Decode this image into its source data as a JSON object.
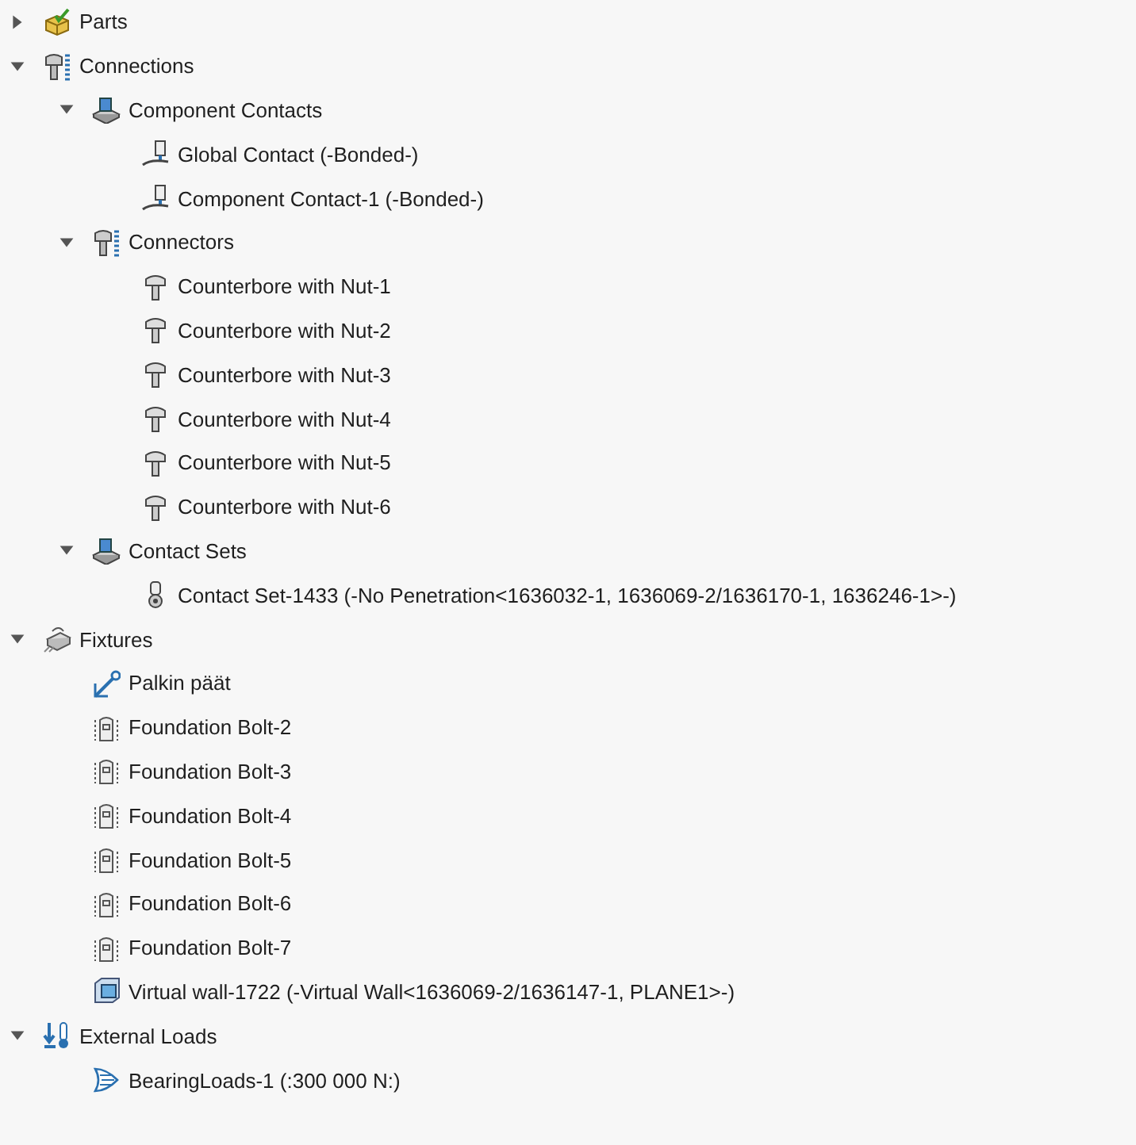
{
  "tree": [
    {
      "label": "Parts",
      "kind": "parts",
      "expanded": false
    },
    {
      "label": "Connections",
      "kind": "connections",
      "expanded": true,
      "children": [
        {
          "label": "Component Contacts",
          "kind": "contact-group",
          "expanded": true,
          "children": [
            {
              "label": "Global Contact (-Bonded-)",
              "kind": "contact"
            },
            {
              "label": "Component Contact-1 (-Bonded-)",
              "kind": "contact"
            }
          ]
        },
        {
          "label": "Connectors",
          "kind": "connections",
          "expanded": true,
          "children": [
            {
              "label": "Counterbore with Nut-1",
              "kind": "bolt"
            },
            {
              "label": "Counterbore with Nut-2",
              "kind": "bolt"
            },
            {
              "label": "Counterbore with Nut-3",
              "kind": "bolt"
            },
            {
              "label": "Counterbore with Nut-4",
              "kind": "bolt"
            },
            {
              "label": "Counterbore with Nut-5",
              "kind": "bolt"
            },
            {
              "label": "Counterbore with Nut-6",
              "kind": "bolt"
            }
          ]
        },
        {
          "label": "Contact Sets",
          "kind": "contact-group",
          "expanded": true,
          "children": [
            {
              "label": "Contact Set-1433 (-No Penetration<1636032-1, 1636069-2/1636170-1, 1636246-1>-)",
              "kind": "contact-set"
            }
          ]
        }
      ]
    },
    {
      "label": "Fixtures",
      "kind": "fixtures",
      "expanded": true,
      "children": [
        {
          "label": "Palkin päät",
          "kind": "fixed"
        },
        {
          "label": "Foundation Bolt-2",
          "kind": "foundation-bolt"
        },
        {
          "label": "Foundation Bolt-3",
          "kind": "foundation-bolt"
        },
        {
          "label": "Foundation Bolt-4",
          "kind": "foundation-bolt"
        },
        {
          "label": "Foundation Bolt-5",
          "kind": "foundation-bolt"
        },
        {
          "label": "Foundation Bolt-6",
          "kind": "foundation-bolt"
        },
        {
          "label": "Foundation Bolt-7",
          "kind": "foundation-bolt"
        },
        {
          "label": "Virtual wall-1722 (-Virtual Wall<1636069-2/1636147-1, PLANE1>-)",
          "kind": "virtual-wall"
        }
      ]
    },
    {
      "label": "External Loads",
      "kind": "loads",
      "expanded": true,
      "children": [
        {
          "label": "BearingLoads-1 (:300 000 N:)",
          "kind": "bearing-load"
        }
      ]
    }
  ]
}
